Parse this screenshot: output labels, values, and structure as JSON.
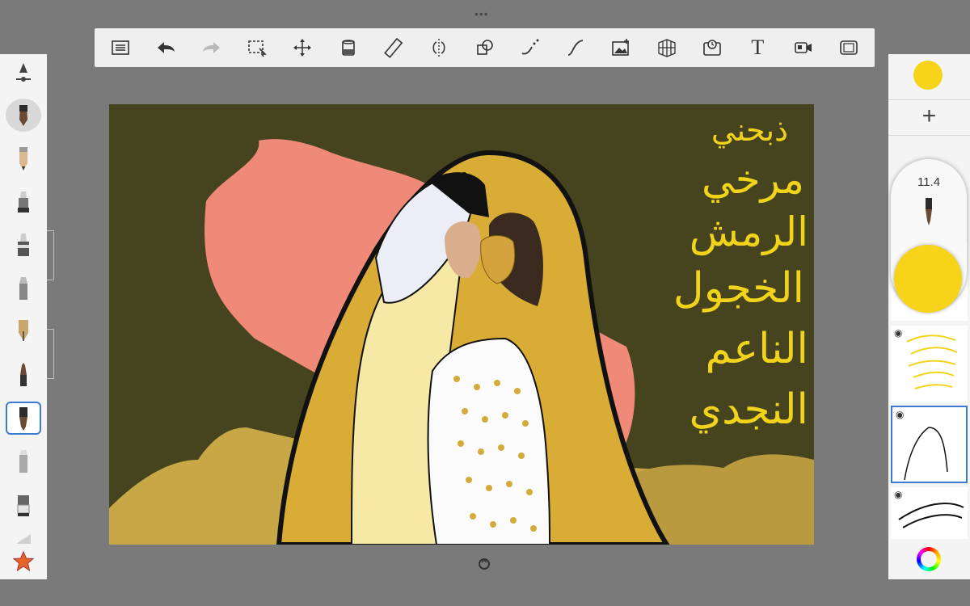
{
  "app": {
    "menu_dots": "•••"
  },
  "toolbar": {
    "buttons": [
      {
        "name": "layers-list-icon"
      },
      {
        "name": "undo-icon"
      },
      {
        "name": "redo-icon"
      },
      {
        "name": "selection-icon"
      },
      {
        "name": "transform-move-icon"
      },
      {
        "name": "fill-bucket-icon"
      },
      {
        "name": "ruler-icon"
      },
      {
        "name": "symmetry-icon"
      },
      {
        "name": "shapes-icon"
      },
      {
        "name": "curve-icon"
      },
      {
        "name": "stroke-icon"
      },
      {
        "name": "add-image-icon"
      },
      {
        "name": "perspective-grid-icon"
      },
      {
        "name": "timelapse-icon"
      },
      {
        "name": "text-tool-icon"
      },
      {
        "name": "record-icon"
      },
      {
        "name": "fullscreen-icon"
      }
    ],
    "text_tool_label": "T"
  },
  "brushes": [
    {
      "name": "brush-settings-icon"
    },
    {
      "name": "round-brush-icon"
    },
    {
      "name": "pencil-icon"
    },
    {
      "name": "marker-icon"
    },
    {
      "name": "fineliner-icon"
    },
    {
      "name": "airbrush-icon"
    },
    {
      "name": "pen-nib-icon"
    },
    {
      "name": "paint-brush-icon"
    },
    {
      "name": "ink-brush-icon"
    },
    {
      "name": "smudge-icon"
    },
    {
      "name": "eraser-icon"
    },
    {
      "name": "more-brushes-icon"
    },
    {
      "name": "favorites-star-icon"
    }
  ],
  "colors": {
    "current": "#f7d41a",
    "accent": "#3b7bd0",
    "canvas_bg": "#45441f",
    "map_pink": "#ef8a78",
    "cloak": "#d9ac35",
    "robe": "#f6e9a6",
    "calligraphy": "#f2d31b"
  },
  "brush_slider": {
    "size": "11.4"
  },
  "layers": {
    "add_label": "+"
  },
  "canvas": {
    "calligraphy_lines": [
      "ذبحني",
      "مرخي",
      "الرمش",
      "الخجول",
      "الناعم",
      "النجدي"
    ]
  }
}
